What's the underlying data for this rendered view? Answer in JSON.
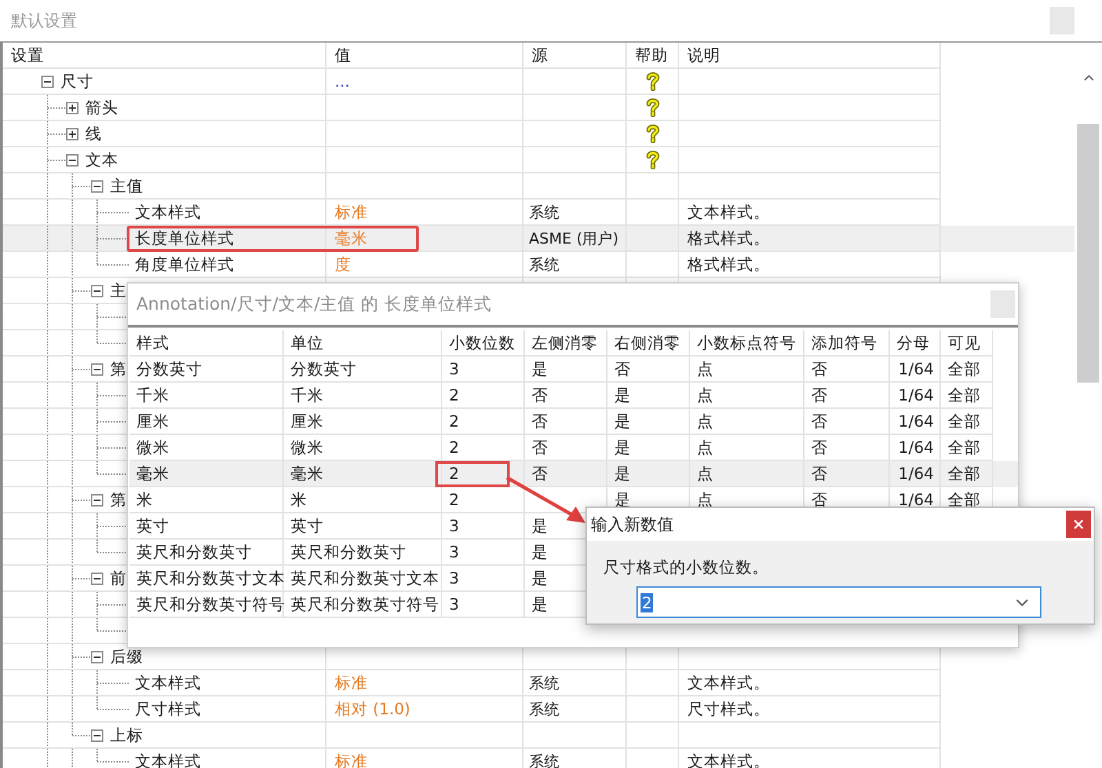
{
  "window": {
    "title": "默认设置"
  },
  "tree": {
    "columns": [
      "设置",
      "值",
      "源",
      "帮助",
      "说明"
    ],
    "rows": [
      {
        "label": "尺寸",
        "value": "...",
        "color": "#3b3bd6",
        "expanded": true,
        "help": true,
        "selected": false,
        "children": [
          {
            "label": "箭头",
            "expanded": false,
            "help": true,
            "selected": false
          },
          {
            "label": "线",
            "expanded": false,
            "help": true,
            "selected": false
          },
          {
            "label": "文本",
            "expanded": true,
            "help": true,
            "selected": false,
            "children": [
              {
                "label": "主值",
                "expanded": true,
                "help": false,
                "selected": false,
                "children": [
                  {
                    "label": "文本样式",
                    "value": "标准",
                    "color": "#e67a22",
                    "source": "系统",
                    "description": "文本样式。",
                    "help": false,
                    "selected": false
                  },
                  {
                    "label": "长度单位样式",
                    "value": "毫米",
                    "color": "#e67a22",
                    "source": "ASME (用户)",
                    "description": "格式样式。",
                    "help": false,
                    "selected": true,
                    "highlighted": true
                  },
                  {
                    "label": "角度单位样式",
                    "value": "度",
                    "color": "#e67a22",
                    "source": "系统",
                    "description": "格式样式。",
                    "help": false,
                    "selected": false
                  }
                ]
              },
              {
                "label": "主",
                "expanded": true,
                "help": false,
                "selected": false,
                "children": [
                  {
                    "kind": "covered"
                  },
                  {
                    "kind": "covered"
                  }
                ]
              },
              {
                "label": "第",
                "expanded": true,
                "help": false,
                "selected": false,
                "children": [
                  {
                    "kind": "covered"
                  },
                  {
                    "kind": "covered"
                  },
                  {
                    "kind": "covered"
                  },
                  {
                    "kind": "covered"
                  }
                ]
              },
              {
                "label": "第",
                "expanded": true,
                "help": false,
                "selected": false,
                "children": [
                  {
                    "kind": "covered"
                  },
                  {
                    "kind": "covered"
                  }
                ]
              },
              {
                "label": "前",
                "expanded": true,
                "help": false,
                "selected": false,
                "children": [
                  {
                    "kind": "covered"
                  },
                  {
                    "kind": "covered"
                  }
                ]
              },
              {
                "label": "后缀",
                "expanded": true,
                "help": false,
                "selected": false,
                "children": [
                  {
                    "label": "文本样式",
                    "value": "标准",
                    "color": "#e67a22",
                    "source": "系统",
                    "description": "文本样式。",
                    "help": false,
                    "selected": false
                  },
                  {
                    "label": "尺寸样式",
                    "value": "相对 (1.0)",
                    "color": "#e67a22",
                    "source": "系统",
                    "description": "尺寸样式。",
                    "help": false,
                    "selected": false
                  }
                ]
              },
              {
                "label": "上标",
                "expanded": true,
                "help": false,
                "selected": false,
                "children": [
                  {
                    "label": "文本样式",
                    "value": "标准",
                    "color": "#e67a22",
                    "source": "系统",
                    "description": "文本样式。",
                    "help": false,
                    "selected": false
                  }
                ]
              }
            ]
          }
        ]
      }
    ]
  },
  "style_dialog": {
    "title": "Annotation/尺寸/文本/主值 的 长度单位样式",
    "columns": [
      "样式",
      "单位",
      "小数位数",
      "左侧消零",
      "右侧消零",
      "小数标点符号",
      "添加符号",
      "分母",
      "可见"
    ],
    "rows": [
      {
        "cells": [
          "分数英寸",
          "分数英寸",
          "3",
          "是",
          "否",
          "点",
          "否",
          "1/64",
          "全部"
        ],
        "selected": false
      },
      {
        "cells": [
          "千米",
          "千米",
          "2",
          "否",
          "是",
          "点",
          "否",
          "1/64",
          "全部"
        ],
        "selected": false
      },
      {
        "cells": [
          "厘米",
          "厘米",
          "2",
          "否",
          "是",
          "点",
          "否",
          "1/64",
          "全部"
        ],
        "selected": false
      },
      {
        "cells": [
          "微米",
          "微米",
          "2",
          "否",
          "是",
          "点",
          "否",
          "1/64",
          "全部"
        ],
        "selected": false
      },
      {
        "cells": [
          "毫米",
          "毫米",
          "2",
          "否",
          "是",
          "点",
          "否",
          "1/64",
          "全部"
        ],
        "selected": true,
        "decimals_highlighted": true
      },
      {
        "cells": [
          "米",
          "米",
          "2",
          null,
          "是",
          "点",
          "否",
          "1/64",
          "全部"
        ],
        "selected": false
      },
      {
        "cells": [
          "英寸",
          "英寸",
          "3",
          "是"
        ],
        "selected": false
      },
      {
        "cells": [
          "英尺和分数英寸",
          "英尺和分数英寸",
          "3",
          "是"
        ],
        "selected": false
      },
      {
        "cells": [
          "英尺和分数英寸文本",
          "英尺和分数英寸文本",
          "3",
          "是"
        ],
        "selected": false
      },
      {
        "cells": [
          "英尺和分数英寸符号",
          "英尺和分数英寸符号",
          "3",
          "是"
        ],
        "selected": false
      }
    ]
  },
  "input_dialog": {
    "title": "输入新数值",
    "prompt": "尺寸格式的小数位数。",
    "value": "2"
  }
}
